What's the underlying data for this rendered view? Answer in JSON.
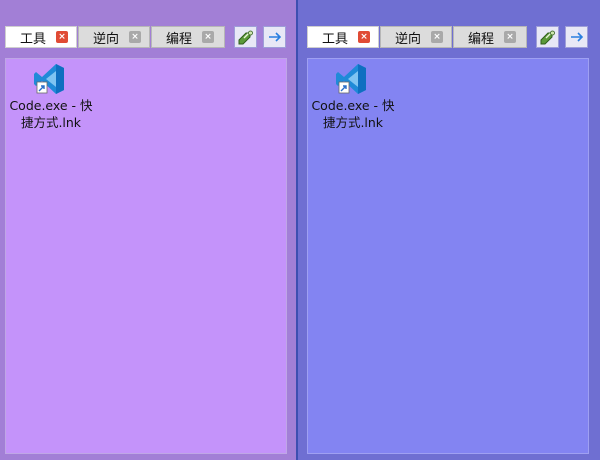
{
  "panels": [
    {
      "tabs": [
        {
          "label": "工具",
          "close": "×",
          "active": true
        },
        {
          "label": "逆向",
          "close": "×",
          "active": false
        },
        {
          "label": "编程",
          "close": "×",
          "active": false
        }
      ],
      "buttons": {
        "link": "link-icon",
        "next": "arrow-right-icon"
      },
      "items": [
        {
          "name_line1": "Code.exe - 快",
          "name_line2": "捷方式.lnk"
        }
      ]
    },
    {
      "tabs": [
        {
          "label": "工具",
          "close": "×",
          "active": true
        },
        {
          "label": "逆向",
          "close": "×",
          "active": false
        },
        {
          "label": "编程",
          "close": "×",
          "active": false
        }
      ],
      "buttons": {
        "link": "link-icon",
        "next": "arrow-right-icon"
      },
      "items": [
        {
          "name_line1": "Code.exe - 快",
          "name_line2": "捷方式.lnk"
        }
      ]
    }
  ],
  "colors": {
    "left_bg": "#a27fd6",
    "left_content": "#c493fa",
    "right_bg": "#6f6fd2",
    "right_content": "#8384f2",
    "active_close": "#e04b35",
    "vscode_blue": "#1f8ad8"
  }
}
